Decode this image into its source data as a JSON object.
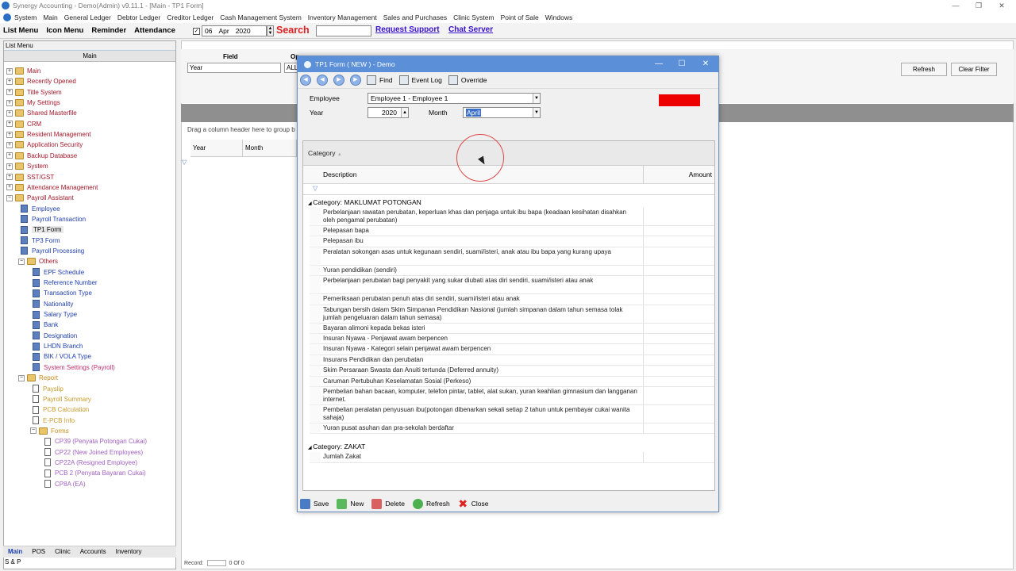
{
  "window": {
    "title": "Synergy Accounting - Demo(Admin) v9.11.1 - [Main - TP1 Form]",
    "controls": [
      "—",
      "❐",
      "✕"
    ]
  },
  "menubar": [
    "System",
    "Main",
    "General Ledger",
    "Debtor Ledger",
    "Creditor Ledger",
    "Cash Management System",
    "Inventory Management",
    "Sales and Purchases",
    "Clinic System",
    "Point of Sale",
    "Windows"
  ],
  "toolbar": {
    "buttons": [
      "List Menu",
      "Icon Menu",
      "Reminder",
      "Attendance"
    ],
    "date_day": "06",
    "date_month": "Apr",
    "date_year": "2020",
    "search_label": "Search",
    "request_support": "Request Support",
    "chat_server": "Chat Server"
  },
  "leftpanel": {
    "title": "List Menu",
    "header": "Main",
    "tree": [
      {
        "label": "Main",
        "color": "red",
        "icon": "folder",
        "indent": 0,
        "exp": "+"
      },
      {
        "label": "Recently Opened",
        "color": "red",
        "icon": "folder",
        "indent": 0,
        "exp": "+"
      },
      {
        "label": "Title System",
        "color": "red",
        "icon": "folder",
        "indent": 0,
        "exp": "+"
      },
      {
        "label": "My Settings",
        "color": "red",
        "icon": "folder",
        "indent": 0,
        "exp": "+"
      },
      {
        "label": "Shared Masterfile",
        "color": "red",
        "icon": "folder",
        "indent": 0,
        "exp": "+"
      },
      {
        "label": "CRM",
        "color": "red",
        "icon": "folder",
        "indent": 0,
        "exp": "+"
      },
      {
        "label": "Resident Management",
        "color": "red",
        "icon": "folder",
        "indent": 0,
        "exp": "+"
      },
      {
        "label": "Application Security",
        "color": "red",
        "icon": "folder",
        "indent": 0,
        "exp": "+"
      },
      {
        "label": "Backup Database",
        "color": "red",
        "icon": "folder",
        "indent": 0,
        "exp": "+"
      },
      {
        "label": "System",
        "color": "red",
        "icon": "folder",
        "indent": 0,
        "exp": "+"
      },
      {
        "label": "SST/GST",
        "color": "red",
        "icon": "folder",
        "indent": 0,
        "exp": "+"
      },
      {
        "label": "Attendance Management",
        "color": "red",
        "icon": "folder",
        "indent": 0,
        "exp": "+"
      },
      {
        "label": "Payroll Assistant",
        "color": "red",
        "icon": "folder",
        "indent": 0,
        "exp": "−"
      },
      {
        "label": "Employee",
        "color": "blue",
        "icon": "form",
        "indent": 1,
        "exp": ""
      },
      {
        "label": "Payroll Transaction",
        "color": "blue",
        "icon": "form",
        "indent": 1,
        "exp": ""
      },
      {
        "label": "TP1 Form",
        "color": "black",
        "icon": "form",
        "indent": 1,
        "exp": ""
      },
      {
        "label": "TP3 Form",
        "color": "blue",
        "icon": "form",
        "indent": 1,
        "exp": ""
      },
      {
        "label": "Payroll Processing",
        "color": "blue",
        "icon": "form",
        "indent": 1,
        "exp": ""
      },
      {
        "label": "Others",
        "color": "red",
        "icon": "folder",
        "indent": 1,
        "exp": "−"
      },
      {
        "label": "EPF Schedule",
        "color": "blue",
        "icon": "form",
        "indent": 2,
        "exp": ""
      },
      {
        "label": "Reference Number",
        "color": "blue",
        "icon": "form",
        "indent": 2,
        "exp": ""
      },
      {
        "label": "Transaction Type",
        "color": "blue",
        "icon": "form",
        "indent": 2,
        "exp": ""
      },
      {
        "label": "Nationality",
        "color": "blue",
        "icon": "form",
        "indent": 2,
        "exp": ""
      },
      {
        "label": "Salary Type",
        "color": "blue",
        "icon": "form",
        "indent": 2,
        "exp": ""
      },
      {
        "label": "Bank",
        "color": "blue",
        "icon": "form",
        "indent": 2,
        "exp": ""
      },
      {
        "label": "Designation",
        "color": "blue",
        "icon": "form",
        "indent": 2,
        "exp": ""
      },
      {
        "label": "LHDN Branch",
        "color": "blue",
        "icon": "form",
        "indent": 2,
        "exp": ""
      },
      {
        "label": "BIK / VOLA Type",
        "color": "blue",
        "icon": "form",
        "indent": 2,
        "exp": ""
      },
      {
        "label": "System Settings (Payroll)",
        "color": "pink",
        "icon": "form",
        "indent": 2,
        "exp": ""
      },
      {
        "label": "Report",
        "color": "orange",
        "icon": "folder",
        "indent": 1,
        "exp": "−"
      },
      {
        "label": "Payslip",
        "color": "gold",
        "icon": "doc",
        "indent": 2,
        "exp": ""
      },
      {
        "label": "Payroll Summary",
        "color": "gold",
        "icon": "doc",
        "indent": 2,
        "exp": ""
      },
      {
        "label": "PCB Calculation",
        "color": "gold",
        "icon": "doc",
        "indent": 2,
        "exp": ""
      },
      {
        "label": "E-PCB Info",
        "color": "gold",
        "icon": "doc",
        "indent": 2,
        "exp": ""
      },
      {
        "label": "Forms",
        "color": "orange",
        "icon": "folder",
        "indent": 2,
        "exp": "−"
      },
      {
        "label": "CP39 (Penyata Potongan Cukai)",
        "color": "purple",
        "icon": "doc",
        "indent": 3,
        "exp": ""
      },
      {
        "label": "CP22 (New Joined Employees)",
        "color": "purple",
        "icon": "doc",
        "indent": 3,
        "exp": ""
      },
      {
        "label": "CP22A (Resigned Employee)",
        "color": "purple",
        "icon": "doc",
        "indent": 3,
        "exp": ""
      },
      {
        "label": "PCB 2 (Penyata Bayaran Cukai)",
        "color": "purple",
        "icon": "doc",
        "indent": 3,
        "exp": ""
      },
      {
        "label": "CP8A (EA)",
        "color": "purple",
        "icon": "doc",
        "indent": 3,
        "exp": ""
      }
    ],
    "bottom_tabs": [
      "Main",
      "POS",
      "Clinic",
      "Accounts",
      "Inventory"
    ],
    "footer": "S & P"
  },
  "filter": {
    "field_label": "Field",
    "op_label": "Op",
    "field_value": "Year",
    "op_value": "ALL",
    "refresh": "Refresh",
    "clear_filter": "Clear Filter",
    "drag_hint": "Drag a column header here to group b",
    "col_year": "Year",
    "col_month": "Month",
    "record_label": "Record:",
    "record_of": "0 Of 0"
  },
  "dialog": {
    "title": "TP1 Form ( NEW ) - Demo",
    "toolbar": {
      "find": "Find",
      "event_log": "Event Log",
      "override": "Override"
    },
    "employee_label": "Employee",
    "employee_value": "Employee 1 - Employee 1",
    "year_label": "Year",
    "year_value": "2020",
    "month_label": "Month",
    "month_value": "April",
    "marker_color": "#ee0000",
    "group_by": "Category",
    "col_description": "Description",
    "col_amount": "Amount",
    "categories": [
      {
        "title": "Category:  MAKLUMAT POTONGAN",
        "items": [
          "Perbelanjaan rawatan perubatan, keperluan khas dan penjaga untuk ibu bapa (keadaan kesihatan disahkan oleh pengamal perubatan)",
          "Pelepasan bapa",
          "Pelepasan ibu",
          "Peralatan sokongan asas untuk kegunaan sendiri, suami/isteri, anak atau ibu bapa yang kurang upaya",
          "Yuran pendidikan (sendiri)",
          "Perbelanjaan perubatan bagi penyakit yang sukar diubati atas diri sendiri, suami/isteri atau anak",
          "Pemeriksaan perubatan penuh atas diri sendiri, suami/isteri atau anak",
          "Tabungan bersih dalam Skim Simpanan Pendidikan Nasional (jumlah simpanan dalam tahun semasa tolak jumlah pengeluaran dalam tahun semasa)",
          "Bayaran alimoni kepada bekas isteri",
          "Insuran Nyawa - Penjawat awam berpencen",
          "Insuran Nyawa - Kategori selain penjawat awam berpencen",
          "Insurans Pendidikan dan perubatan",
          "Skim Persaraan Swasta dan Anuiti tertunda (Deferred annuity)",
          "Caruman Pertubuhan Keselamatan Sosial (Perkeso)",
          "Pembelian bahan bacaan, komputer, telefon pintar, tablet, alat sukan, yuran keahlian gimnasium dan langganan internet.",
          "Pembelian peralatan penyusuan ibu(potongan dibenarkan sekali setiap 2 tahun untuk pembayar cukai wanita sahaja)",
          "Yuran pusat asuhan dan pra-sekolah berdaftar"
        ]
      },
      {
        "title": "Category:  ZAKAT",
        "items": [
          "Jumlah Zakat"
        ]
      }
    ],
    "bottom": {
      "save": "Save",
      "new": "New",
      "delete": "Delete",
      "refresh": "Refresh",
      "close": "Close"
    }
  }
}
